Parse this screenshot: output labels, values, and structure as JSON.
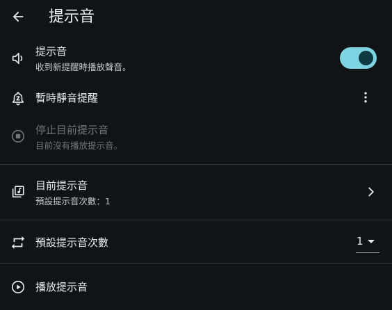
{
  "header": {
    "title": "提示音",
    "back_icon": "arrow-back-icon"
  },
  "rows": {
    "alert_sound": {
      "title": "提示音",
      "subtitle": "收到新提醒時播放聲音。",
      "icon": "volume-icon",
      "toggle_on": true
    },
    "snooze": {
      "title": "暫時靜音提醒",
      "icon": "snooze-bell-icon",
      "menu_icon": "more-vert-icon"
    },
    "stop_sound": {
      "title": "停止目前提示音",
      "subtitle": "目前沒有播放提示音。",
      "icon": "stop-circle-icon",
      "enabled": false
    },
    "current_sound": {
      "title": "目前提示音",
      "subtitle": "預設提示音次數：1",
      "icon": "music-library-icon",
      "chevron_icon": "chevron-right-icon"
    },
    "repeat_count": {
      "title": "預設提示音次數",
      "icon": "repeat-icon",
      "selected_value": "1"
    },
    "play_sound": {
      "title": "播放提示音",
      "icon": "play-circle-icon"
    }
  },
  "colors": {
    "background": "#111417",
    "toggle_track": "#7fd4e4",
    "toggle_knob": "#0e3a44",
    "divider": "#2f3438",
    "disabled_text": "#6f757a"
  }
}
